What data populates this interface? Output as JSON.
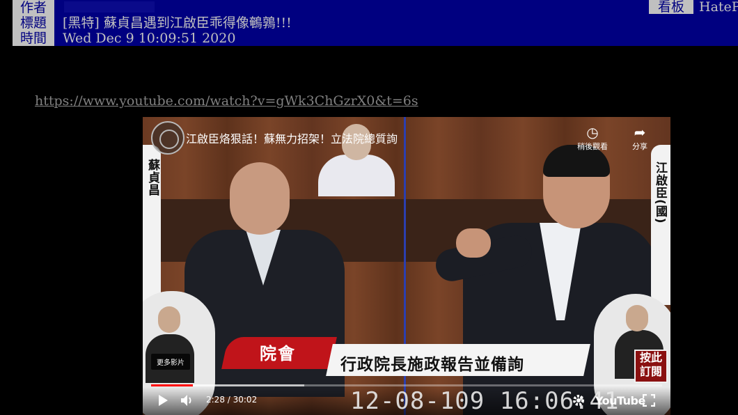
{
  "header": {
    "author_label": "作者",
    "title_label": "標題",
    "title_value": "[黑特] 蘇貞昌遇到江啟臣乖得像鵪鶉!!!",
    "time_label": "時間",
    "time_value": "Wed Dec  9 10:09:51 2020",
    "board_label": "看板",
    "board_value": "HateP"
  },
  "link": {
    "url": "https://www.youtube.com/watch?v=gWk3ChGzrX0&t=6s"
  },
  "video": {
    "title": "江啟臣烙狠話！蘇無力招架！立法院總質詢",
    "watch_later_label": "稍後觀看",
    "share_label": "分享",
    "left_name": "蘇貞昌",
    "right_name": "江啟臣(國)",
    "red_banner": "院會",
    "white_banner": "行政院長施政報告並備詢",
    "more_videos_label": "更多影片",
    "subscribe_label": "按此訂閱",
    "time_display": "2:28 / 30:02",
    "overlay_timestamp": "12-08-109 16:06:41",
    "youtube_label": "YouTube",
    "progress_played": 0.082,
    "progress_loaded": 0.3,
    "icons": {
      "play": "play-icon",
      "volume": "volume-icon",
      "settings": "gear-icon",
      "fullscreen": "fullscreen-icon",
      "watch_later": "clock-icon",
      "share": "share-arrow-icon"
    },
    "colors": {
      "progress": "#ff0000",
      "divider": "#2b3fb0",
      "red_banner": "#c0141a"
    }
  }
}
